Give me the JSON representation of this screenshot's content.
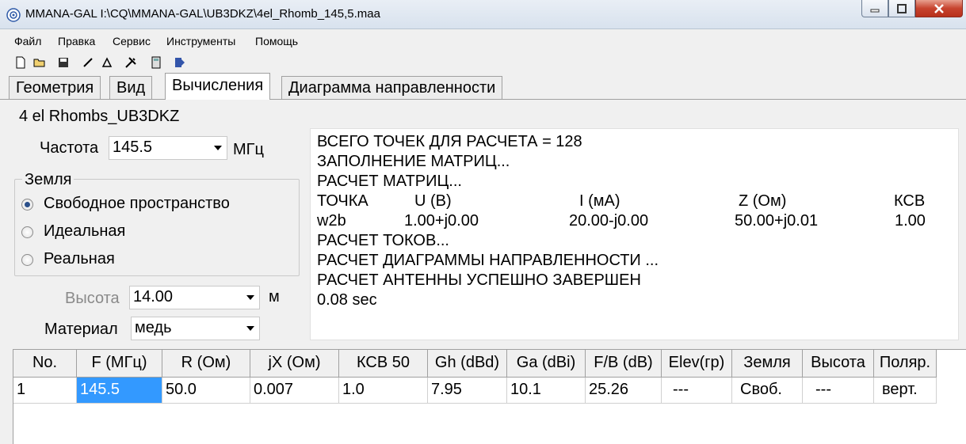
{
  "window": {
    "title": "MMANA-GAL I:\\CQ\\MMANA-GAL\\UB3DKZ\\4el_Rhomb_145,5.maa"
  },
  "menu": [
    "Файл",
    "Правка",
    "Сервис",
    "Инструменты",
    "Помощь"
  ],
  "toolbar": [
    "new-file-icon",
    "open-folder-icon",
    "save-icon",
    "line-icon",
    "triangle-icon",
    "tools-icon",
    "calculator-icon",
    "run-icon"
  ],
  "tabs": [
    "Геометрия",
    "Вид",
    "Вычисления",
    "Диаграмма направленности"
  ],
  "active_tab": "Вычисления",
  "project_name": "4 el Rhombs_UB3DKZ",
  "frequency": {
    "label": "Частота",
    "value": "145.5",
    "unit": "МГц"
  },
  "ground": {
    "title": "Земля",
    "options": [
      "Свободное пространство",
      "Идеальная",
      "Реальная"
    ],
    "selected": "Свободное пространство"
  },
  "height": {
    "label": "Высота",
    "value": "14.00",
    "unit": "м"
  },
  "material": {
    "label": "Материал",
    "value": "медь"
  },
  "log": {
    "lines_top": [
      "ВСЕГО ТОЧЕК ДЛЯ РАСЧЕТА = 128",
      "ЗАПОЛНЕНИЕ МАТРИЦ...",
      "РАСЧЕТ МАТРИЦ..."
    ],
    "table_header": [
      "ТОЧКА",
      "U (В)",
      "I (мА)",
      "Z (Ом)",
      "КСВ"
    ],
    "table_row": [
      "w2b",
      "1.00+j0.00",
      "20.00-j0.00",
      "50.00+j0.01",
      "1.00"
    ],
    "lines_bottom": [
      "РАСЧЕТ ТОКОВ...",
      "РАСЧЕТ ДИАГРАММЫ НАПРАВЛЕННОСТИ ...",
      "РАСЧЕТ АНТЕННЫ УСПЕШНО ЗАВЕРШЕН",
      "0.08 sec"
    ]
  },
  "grid": {
    "headers": [
      "No.",
      "F (МГц)",
      "R (Ом)",
      "jX (Ом)",
      "КСВ 50",
      "Gh (dBd)",
      "Ga (dBi)",
      "F/B (dB)",
      "Elev(гр)",
      "Земля",
      "Высота",
      "Поляр."
    ],
    "rows": [
      [
        "1",
        "145.5",
        "50.0",
        "0.007",
        "1.0",
        "7.95",
        "10.1",
        "25.26",
        "---",
        "Своб.",
        "---",
        "верт."
      ]
    ]
  },
  "colors": {
    "selection": "#3399ff",
    "close_button": "#c7442f"
  }
}
